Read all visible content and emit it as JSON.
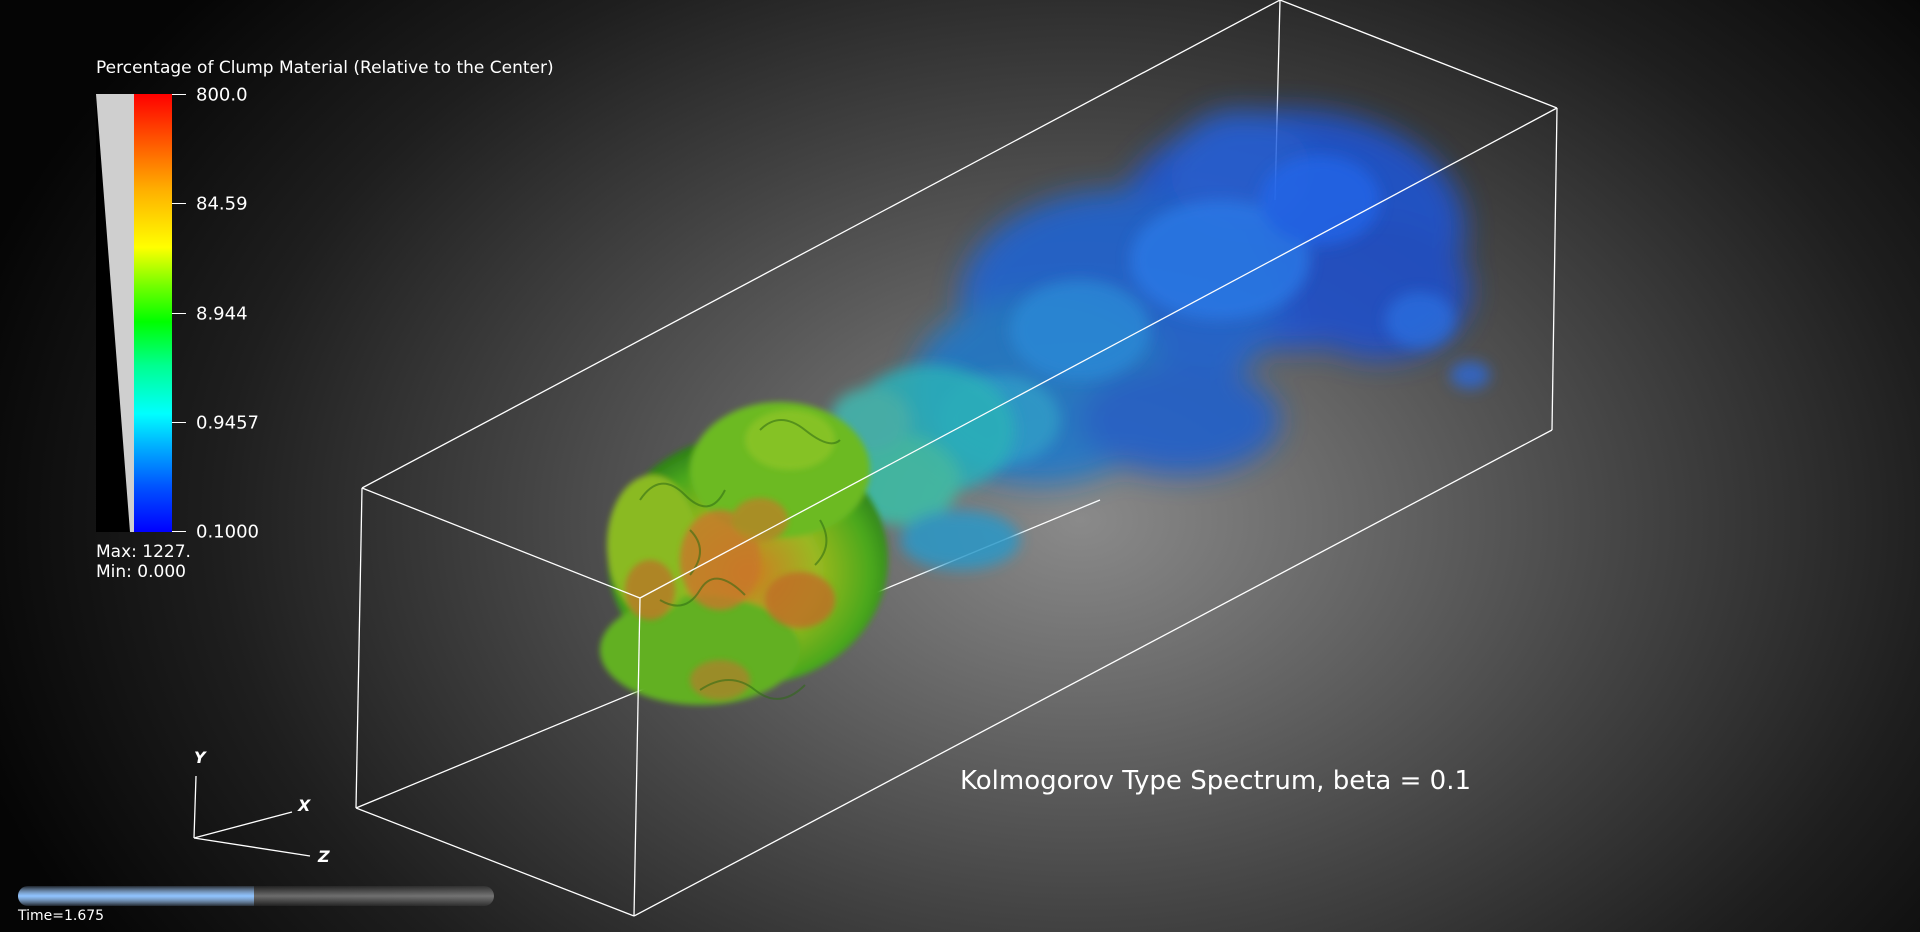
{
  "legend": {
    "title": "Percentage of Clump Material (Relative to the Center)",
    "ticks": [
      "800.0",
      "84.59",
      "8.944",
      "0.9457",
      "0.1000"
    ],
    "max_label": "Max:  1227.",
    "min_label": "Min:  0.000"
  },
  "caption": "Kolmogorov Type Spectrum, beta = 0.1",
  "axes": {
    "y": "Y",
    "x": "X",
    "z": "Z"
  },
  "animation": {
    "time_label": "Time=1.675",
    "progress": 0.495
  },
  "colors": {
    "low": "#0000ff",
    "mid": "#00ff00",
    "high": "#ff0000",
    "box_edges": "#ffffff"
  }
}
